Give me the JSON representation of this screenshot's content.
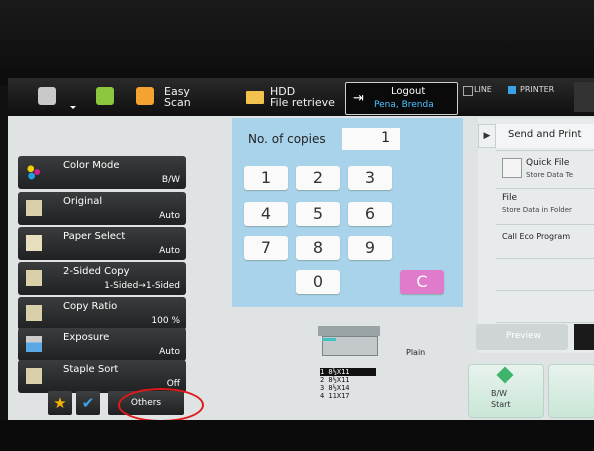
{
  "topbar": {
    "easy_scan_line1": "Easy",
    "easy_scan_line2": "Scan",
    "hdd_line1": "HDD",
    "hdd_line2": "File retrieve",
    "logout_label": "Logout",
    "logout_user": "Pena, Brenda",
    "line_label": "LINE",
    "printer_label": "PRINTER"
  },
  "settings": [
    {
      "label": "Color Mode",
      "value": "B/W"
    },
    {
      "label": "Original",
      "value": "Auto"
    },
    {
      "label": "Paper Select",
      "value": "Auto"
    },
    {
      "label": "2-Sided Copy",
      "value": "1-Sided→1-Sided"
    },
    {
      "label": "Copy Ratio",
      "value": "100 %"
    },
    {
      "label": "Exposure",
      "value": "Auto"
    },
    {
      "label": "Staple Sort",
      "value": "Off"
    }
  ],
  "keypad": {
    "copies_label": "No. of copies",
    "copies_value": "1",
    "keys": [
      "1",
      "2",
      "3",
      "4",
      "5",
      "6",
      "7",
      "8",
      "9",
      "0"
    ],
    "clear_label": "C"
  },
  "right": {
    "send_print": "Send and Print",
    "quick_file": "Quick File",
    "quick_file_sub": "Store Data Te",
    "file": "File",
    "file_sub": "Store Data in Folder",
    "eco": "Call Eco Program"
  },
  "tray": {
    "paper_type": "Plain",
    "trays": [
      "1  8½X11",
      "2  8½X11",
      "3  8½X14",
      "4  11X17"
    ]
  },
  "bottom": {
    "others_label": "Others",
    "preview_label": "Preview",
    "bw_start_line1": "B/W",
    "bw_start_line2": "Start"
  },
  "colors": {
    "accent_annotation": "#e01818",
    "keypad_bg": "#a8d3ea",
    "clear_key": "#e07acb",
    "start_green": "#3fb56c"
  }
}
